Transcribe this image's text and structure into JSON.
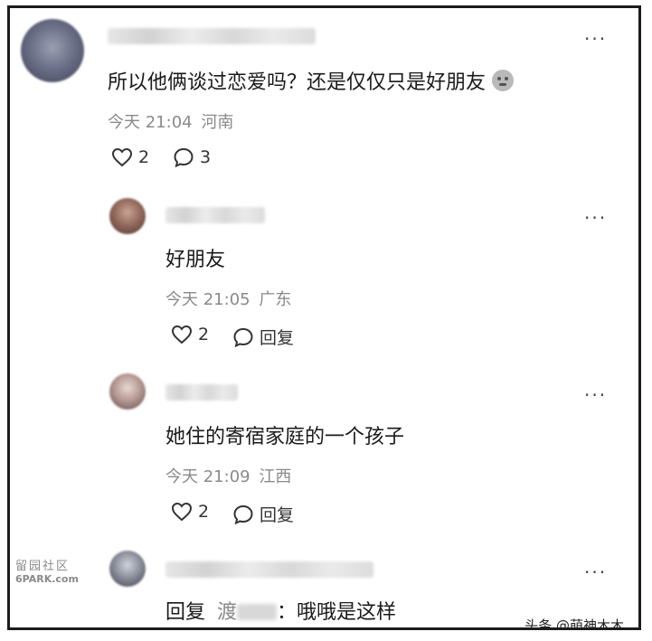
{
  "comments": [
    {
      "text": "所以他俩谈过恋爱吗？还是仅仅只是好朋友",
      "time": "今天 21:04",
      "location": "河南",
      "likes": "2",
      "replies": "3"
    },
    {
      "text": "好朋友",
      "time": "今天 21:05",
      "location": "广东",
      "likes": "2",
      "reply_label": "回复"
    },
    {
      "text": "她住的寄宿家庭的一个孩子",
      "time": "今天 21:09",
      "location": "江西",
      "likes": "2",
      "reply_label": "回复"
    },
    {
      "reply_prefix": "回复",
      "reply_to": "渡",
      "text": "：哦哦是这样"
    }
  ],
  "more_label": "···",
  "watermarks": {
    "left_top": "留园社区",
    "left_bottom": "6PARK.com",
    "right": "头条 @萌神木木"
  }
}
